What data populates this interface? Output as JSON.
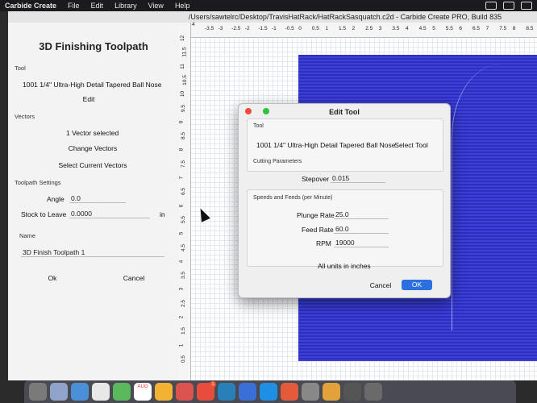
{
  "menubar": {
    "app_name": "Carbide Create",
    "items": [
      "File",
      "Edit",
      "Library",
      "View",
      "Help"
    ]
  },
  "window": {
    "title": "/Users/sawtelrc/Desktop/TravisHatRack/HatRackSasquatch.c2d - Carbide Create PRO, Build 835"
  },
  "panel": {
    "heading": "3D Finishing Toolpath",
    "tool_label": "Tool",
    "tool_name": "1001 1/4\" Ultra-High Detail Tapered Ball Nose",
    "edit_button": "Edit",
    "vectors_label": "Vectors",
    "vectors_selected": "1 Vector selected",
    "change_vectors_button": "Change Vectors",
    "select_current_button": "Select Current Vectors",
    "settings_label": "Toolpath Settings",
    "angle_label": "Angle",
    "angle_value": "0.0",
    "stock_label": "Stock to Leave",
    "stock_value": "0.0000",
    "stock_unit": "in",
    "name_label": "Name",
    "name_value": "3D Finish Toolpath 1",
    "ok_button": "Ok",
    "cancel_button": "Cancel"
  },
  "ruler": {
    "top": [
      "-3.5",
      "-3",
      "-2.5",
      "-2",
      "-1.5",
      "-1",
      "-0.5",
      "0",
      "0.5",
      "1",
      "1.5",
      "2",
      "2.5",
      "3",
      "3.5",
      "4",
      "4.5",
      "5",
      "5.5",
      "6",
      "6.5",
      "7",
      "7.5",
      "8",
      "8.5"
    ],
    "top_start": "4",
    "left": [
      "12",
      "11.5",
      "11",
      "10.5",
      "10",
      "9.5",
      "9",
      "8.5",
      "8",
      "7.5",
      "7",
      "6.5",
      "6",
      "5.5",
      "5",
      "4.5",
      "4",
      "3.5",
      "3",
      "2.5",
      "2",
      "1.5",
      "1",
      "0.5"
    ]
  },
  "dialog": {
    "title": "Edit Tool",
    "tool_label": "Tool",
    "tool_name": "1001 1/4\" Ultra-High Detail Tapered Ball Nose",
    "select_tool_button": "Select Tool",
    "cutting_label": "Cutting Parameters",
    "stepover_label": "Stepover",
    "stepover_value": "0.015",
    "speeds_label": "Speeds and Feeds (per Minute)",
    "plunge_label": "Plunge Rate",
    "plunge_value": "25.0",
    "feed_label": "Feed Rate",
    "feed_value": "60.0",
    "rpm_label": "RPM",
    "rpm_value": "19000",
    "units_note": "All units in inches",
    "cancel_button": "Cancel",
    "ok_button": "OK"
  },
  "dock": {
    "calendar_month": "AUG",
    "badges": [
      "1"
    ]
  },
  "colors": {
    "stock_fill": "#2d2fbf",
    "ok_accent": "#2b6fe0",
    "close_dot": "#ee4b3c",
    "zoom_dot": "#2cc23f"
  }
}
